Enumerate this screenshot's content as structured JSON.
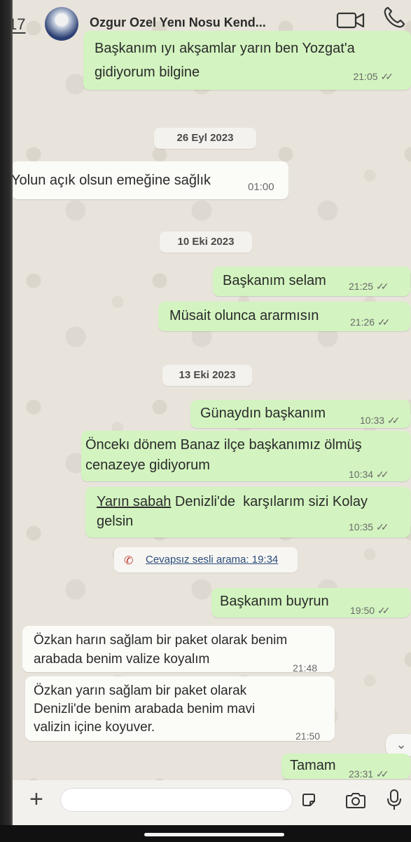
{
  "header": {
    "back_count": "17",
    "contact_name": "Ozgur Ozel Yenı Nosu Kend..."
  },
  "messages": [
    {
      "line1": "Başkanım ıyı akşamlar yarın ben Yozgat'a",
      "line2": "gidiyorum bilgine",
      "time": "21:05"
    },
    {
      "date": "26 Eyl 2023"
    },
    {
      "text": "Yolun açık olsun emeğine sağlık",
      "time": "01:00"
    },
    {
      "date": "10 Eki 2023"
    },
    {
      "text": "Başkanım selam",
      "time": "21:25"
    },
    {
      "text": "Müsait olunca ararmısın",
      "time": "21:26"
    },
    {
      "date": "13 Eki 2023"
    },
    {
      "text": "Günaydın başkanım",
      "time": "10:33"
    },
    {
      "line1": "Öncekı dönem Banaz ilçe başkanımız ölmüş",
      "line2": "cenazeye gidiyorum",
      "time": "10:34"
    },
    {
      "line1_link": "Yarın sabah",
      "line1_rest": " Denizli'de  karşılarım sizi Kolay",
      "line2": "gelsin",
      "time": "10:35"
    },
    {
      "call_text": "Cevapsız sesli arama: 19:34"
    },
    {
      "text": "Başkanım buyrun",
      "time": "19:50"
    },
    {
      "line1": "Özkan harın sağlam bir paket olarak benim",
      "line2": "arabada benim valize koyalım",
      "time": "21:48"
    },
    {
      "line1": "Özkan yarın sağlam bir paket olarak",
      "line2": "Denizli'de benim arabada benim mavi",
      "line3": "valizin içine koyuver.",
      "time": "21:50"
    },
    {
      "text": "Tamam",
      "time": "23:31"
    }
  ],
  "ticks": "✓✓"
}
